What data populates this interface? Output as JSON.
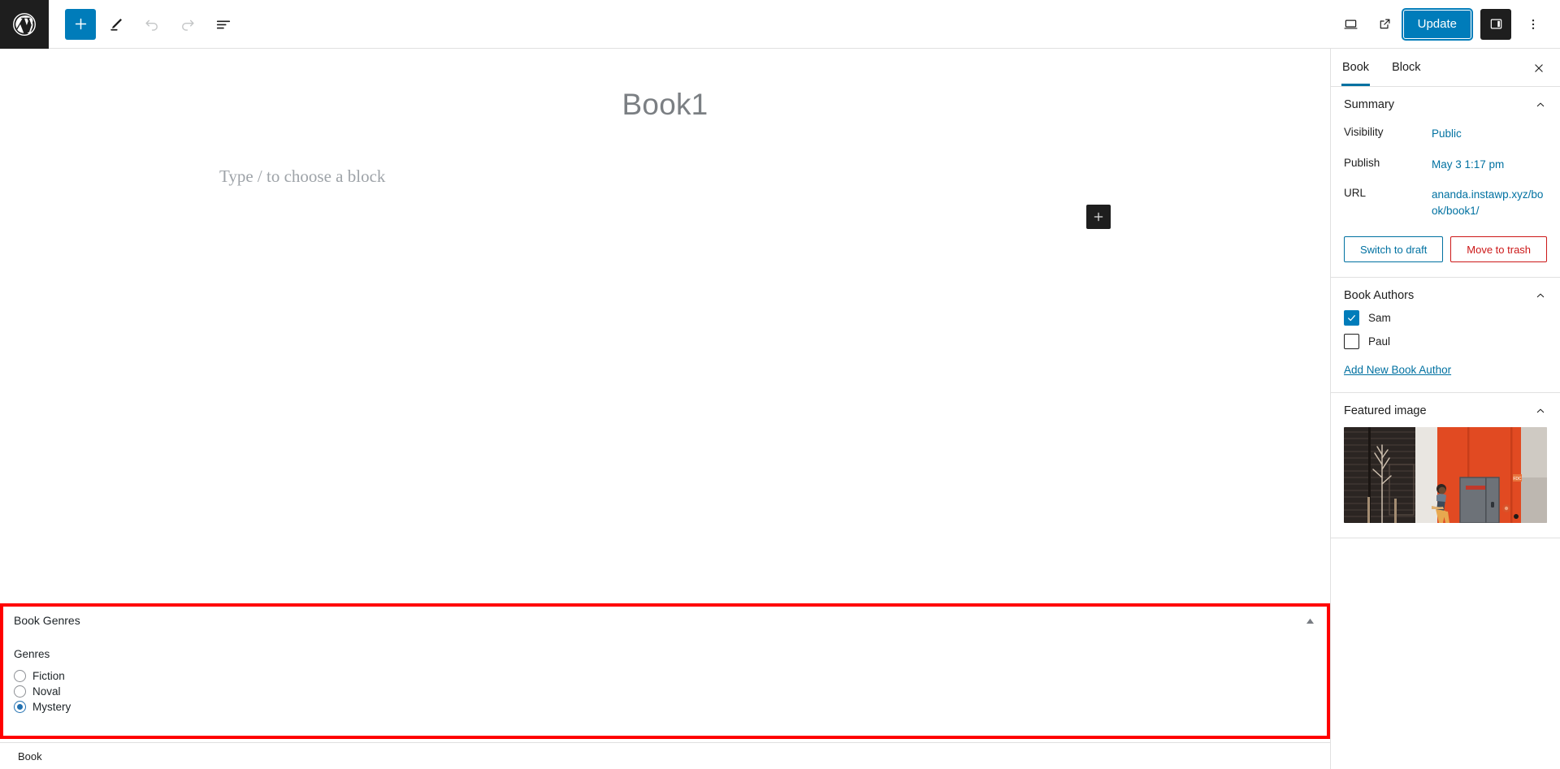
{
  "toolbar": {
    "logo_icon": "wordpress-logo-icon",
    "add_block_label": "+",
    "add_block_icon": "plus-icon",
    "tools_icon": "pencil-icon",
    "undo_icon": "undo-icon",
    "redo_icon": "redo-icon",
    "list_view_icon": "list-view-icon",
    "preview_icon": "desktop-preview-icon",
    "view_post_icon": "external-link-icon",
    "update_label": "Update",
    "settings_icon": "sidebar-panel-icon",
    "options_icon": "kebab-menu-icon",
    "accent_color": "#007cba"
  },
  "editor": {
    "title": "Book1",
    "block_placeholder": "Type / to choose a block",
    "inserter_icon": "plus-icon"
  },
  "sidebar": {
    "tabs": [
      {
        "label": "Book",
        "active": true
      },
      {
        "label": "Block",
        "active": false
      }
    ],
    "close_icon": "close-icon",
    "summary": {
      "title": "Summary",
      "collapse_icon": "chevron-up-icon",
      "rows": [
        {
          "label": "Visibility",
          "value": "Public"
        },
        {
          "label": "Publish",
          "value": "May 3 1:17 pm"
        },
        {
          "label": "URL",
          "value": "ananda.instawp.xyz/book/book1/"
        }
      ],
      "switch_to_draft": "Switch to draft",
      "move_to_trash": "Move to trash",
      "draft_color": "#0071a1",
      "trash_color": "#cc1818"
    },
    "book_authors": {
      "title": "Book Authors",
      "collapse_icon": "chevron-up-icon",
      "items": [
        {
          "label": "Sam",
          "checked": true
        },
        {
          "label": "Paul",
          "checked": false
        }
      ],
      "add_link": "Add New Book Author"
    },
    "featured_image": {
      "title": "Featured image",
      "collapse_icon": "chevron-up-icon",
      "image_alt": "man walking past orange building facade"
    }
  },
  "metabox": {
    "title": "Book Genres",
    "toggle_icon": "triangle-up-icon",
    "field_label": "Genres",
    "highlight_color": "#ff0000",
    "options": [
      {
        "label": "Fiction",
        "selected": false
      },
      {
        "label": "Noval",
        "selected": false
      },
      {
        "label": "Mystery",
        "selected": true
      }
    ]
  },
  "statusbar": {
    "breadcrumb": "Book"
  }
}
